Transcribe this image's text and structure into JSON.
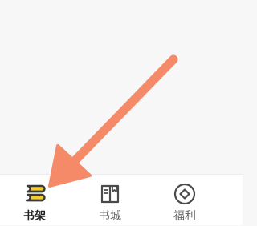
{
  "tabbar": {
    "tabs": [
      {
        "label": "书架",
        "icon": "bookshelf-icon",
        "active": true
      },
      {
        "label": "书城",
        "icon": "book-icon",
        "active": false
      },
      {
        "label": "福利",
        "icon": "coin-icon",
        "active": false
      }
    ]
  },
  "colors": {
    "active_icon": "#f5cc2e",
    "icon_stroke": "#3a3a3a",
    "arrow": "#f58a68",
    "background": "#f7f7f7",
    "tabbar_background": "#ffffff"
  },
  "annotation": {
    "type": "arrow",
    "points_to": "tab-bookshelf"
  }
}
